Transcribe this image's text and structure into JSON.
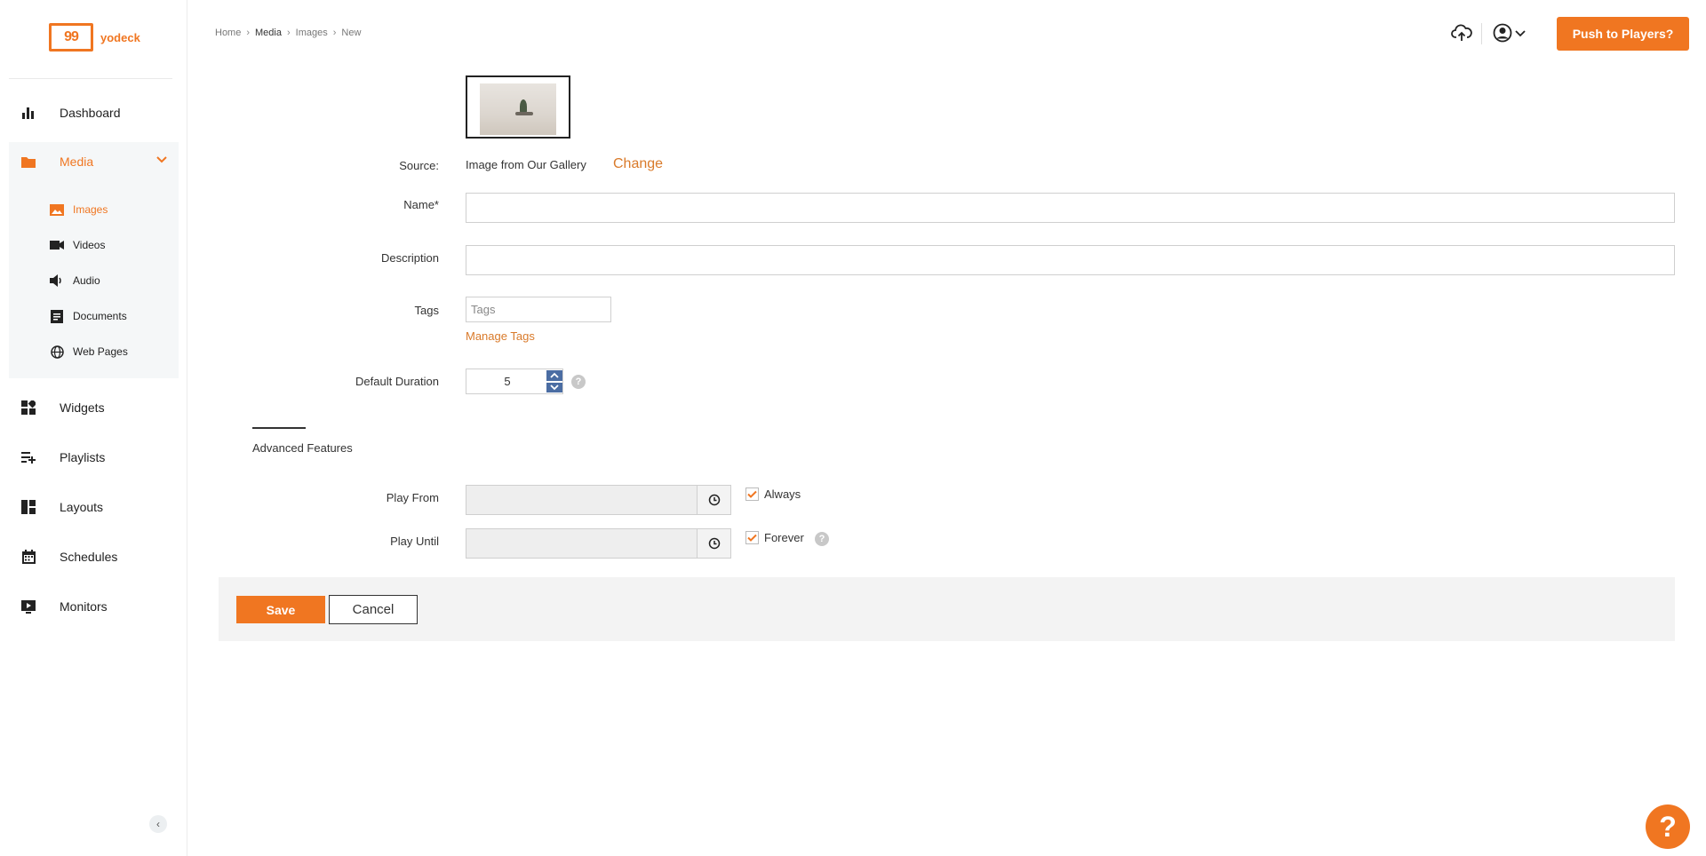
{
  "brand": {
    "logo_glyph": "99",
    "name": "yodeck",
    "accent": "#f07621"
  },
  "sidebar": {
    "items": [
      {
        "label": "Dashboard",
        "icon": "bar-chart-icon"
      },
      {
        "label": "Media",
        "icon": "folder-icon"
      },
      {
        "label": "Widgets",
        "icon": "widgets-icon"
      },
      {
        "label": "Playlists",
        "icon": "playlist-add-icon"
      },
      {
        "label": "Layouts",
        "icon": "layout-icon"
      },
      {
        "label": "Schedules",
        "icon": "calendar-icon"
      },
      {
        "label": "Monitors",
        "icon": "monitor-play-icon"
      }
    ],
    "media_sub": [
      {
        "label": "Images",
        "icon": "image-icon"
      },
      {
        "label": "Videos",
        "icon": "video-camera-icon"
      },
      {
        "label": "Audio",
        "icon": "speaker-icon"
      },
      {
        "label": "Documents",
        "icon": "document-icon"
      },
      {
        "label": "Web Pages",
        "icon": "globe-icon"
      }
    ]
  },
  "breadcrumb": [
    "Home",
    "Media",
    "Images",
    "New"
  ],
  "header": {
    "push_label": "Push to Players?"
  },
  "form": {
    "source_label": "Source:",
    "source_value": "Image from Our Gallery",
    "change_label": "Change",
    "name_label": "Name*",
    "name_value": "",
    "description_label": "Description",
    "description_value": "",
    "tags_label": "Tags",
    "tags_placeholder": "Tags",
    "manage_tags": "Manage Tags",
    "duration_label": "Default Duration",
    "duration_value": "5",
    "advanced_title": "Advanced Features",
    "play_from_label": "Play From",
    "play_until_label": "Play Until",
    "always_label": "Always",
    "forever_label": "Forever",
    "help_glyph": "?"
  },
  "actions": {
    "save": "Save",
    "cancel": "Cancel"
  },
  "fab": {
    "glyph": "?"
  },
  "collapse_glyph": "‹"
}
